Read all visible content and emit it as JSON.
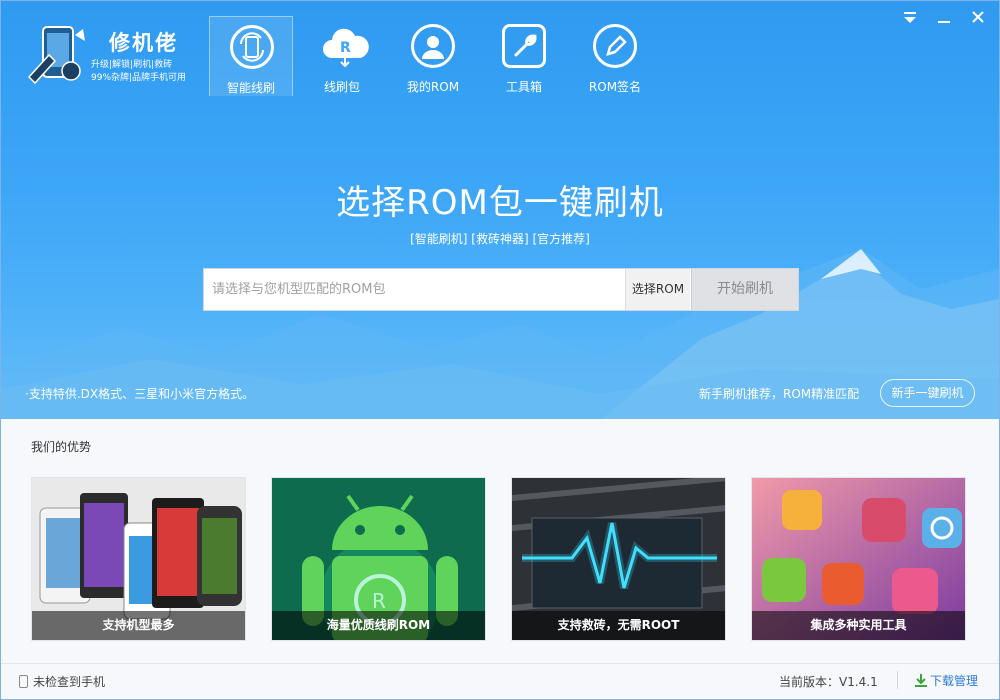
{
  "app": {
    "name": "修机佬",
    "tagline_line1": "升级|解锁|刷机|救砖",
    "tagline_line2": "99%杂牌|品牌手机可用"
  },
  "nav": {
    "items": [
      {
        "label": "智能线刷",
        "icon": "phone-refresh-icon",
        "active": true
      },
      {
        "label": "线刷包",
        "icon": "rom-cloud-icon"
      },
      {
        "label": "我的ROM",
        "icon": "user-icon"
      },
      {
        "label": "工具箱",
        "icon": "wrench-icon"
      },
      {
        "label": "ROM签名",
        "icon": "pen-icon"
      }
    ]
  },
  "hero": {
    "headline": "选择ROM包一键刷机",
    "tags": "[智能刷机] [救砖神器] [官方推荐]",
    "search_placeholder": "请选择与您机型匹配的ROM包",
    "search_value": "",
    "select_rom_label": "选择ROM",
    "start_flash_label": "开始刷机",
    "support_note": "·支持特供.DX格式、三星和小米官方格式。",
    "newbie_text": "新手刷机推荐，ROM精准匹配",
    "newbie_button": "新手一键刷机"
  },
  "advantages": {
    "title": "我们的优势",
    "cards": [
      {
        "caption": "支持机型最多"
      },
      {
        "caption": "海量优质线刷ROM"
      },
      {
        "caption": "支持救砖，无需ROOT"
      },
      {
        "caption": "集成多种实用工具"
      }
    ]
  },
  "status": {
    "phone_status": "未检查到手机",
    "version": "当前版本：V1.4.1",
    "download_manager": "下载管理"
  },
  "colors": {
    "hero_blue": "#3da6f7",
    "link_blue": "#2c7bd3"
  }
}
